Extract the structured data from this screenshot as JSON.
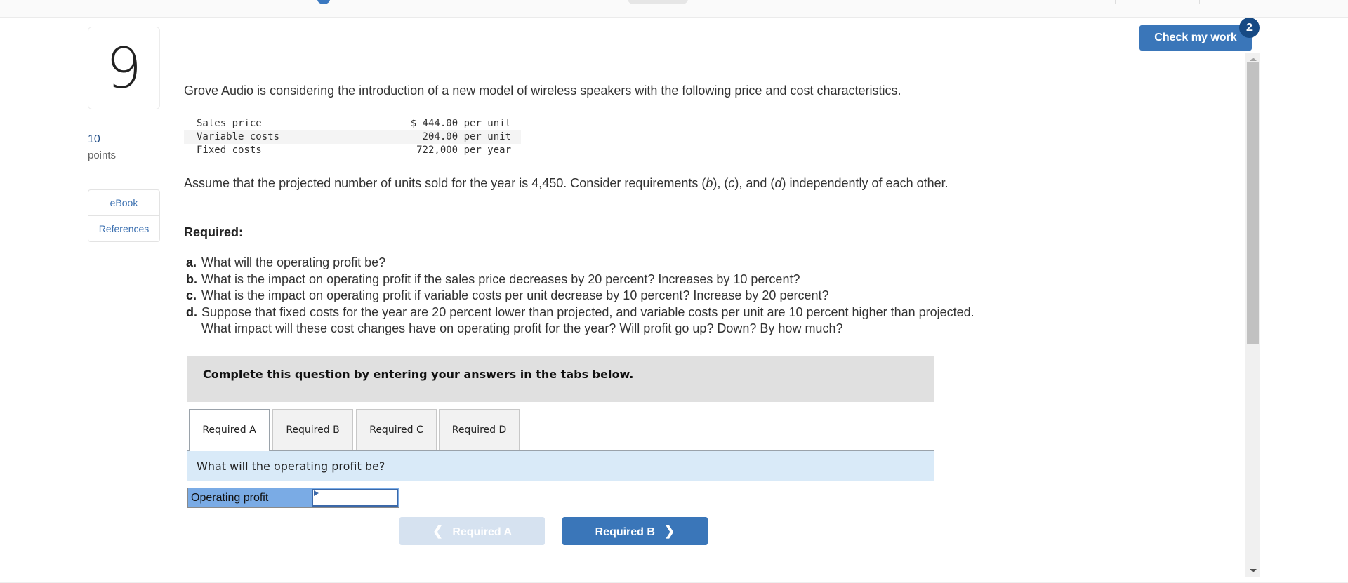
{
  "header": {
    "check_button": "Check my work",
    "check_badge": "2"
  },
  "question": {
    "number": "9",
    "points_value": "10",
    "points_label": "points",
    "side_links": [
      "eBook",
      "References"
    ],
    "intro": "Grove Audio is considering the introduction of a new model of wireless speakers with the following price and cost characteristics.",
    "cost_table": [
      {
        "label": "Sales price",
        "value": "$ 444.00",
        "unit": "per unit"
      },
      {
        "label": "Variable costs",
        "value": "204.00",
        "unit": "per unit"
      },
      {
        "label": "Fixed costs",
        "value": "722,000",
        "unit": "per year"
      }
    ],
    "assumption_parts": {
      "pre": "Assume that the projected number of units sold for the year is 4,450. Consider requirements (",
      "b": "b",
      "mid1": "), (",
      "c": "c",
      "mid2": "), and (",
      "d": "d",
      "post": ") independently of each other."
    },
    "required_heading": "Required:",
    "requirements": [
      {
        "letter": "a.",
        "text": "What will the operating profit be?"
      },
      {
        "letter": "b.",
        "text": "What is the impact on operating profit if the sales price decreases by 20 percent? Increases by 10 percent?"
      },
      {
        "letter": "c.",
        "text": "What is the impact on operating profit if variable costs per unit decrease by 10 percent? Increase by 20 percent?"
      },
      {
        "letter": "d.",
        "text": "Suppose that fixed costs for the year are 20 percent lower than projected, and variable costs per unit are 10 percent higher than projected. What impact will these cost changes have on operating profit for the year? Will profit go up? Down? By how much?"
      }
    ]
  },
  "answer_area": {
    "instruction": "Complete this question by entering your answers in the tabs below.",
    "tabs": [
      {
        "label": "Required A",
        "active": true
      },
      {
        "label": "Required B",
        "active": false
      },
      {
        "label": "Required C",
        "active": false
      },
      {
        "label": "Required D",
        "active": false
      }
    ],
    "prompt": "What will the operating profit be?",
    "row_label": "Operating profit",
    "row_value": "",
    "prev_button": "Required A",
    "next_button": "Required B",
    "prev_icon": "chevron-left-icon",
    "next_icon": "chevron-right-icon"
  }
}
